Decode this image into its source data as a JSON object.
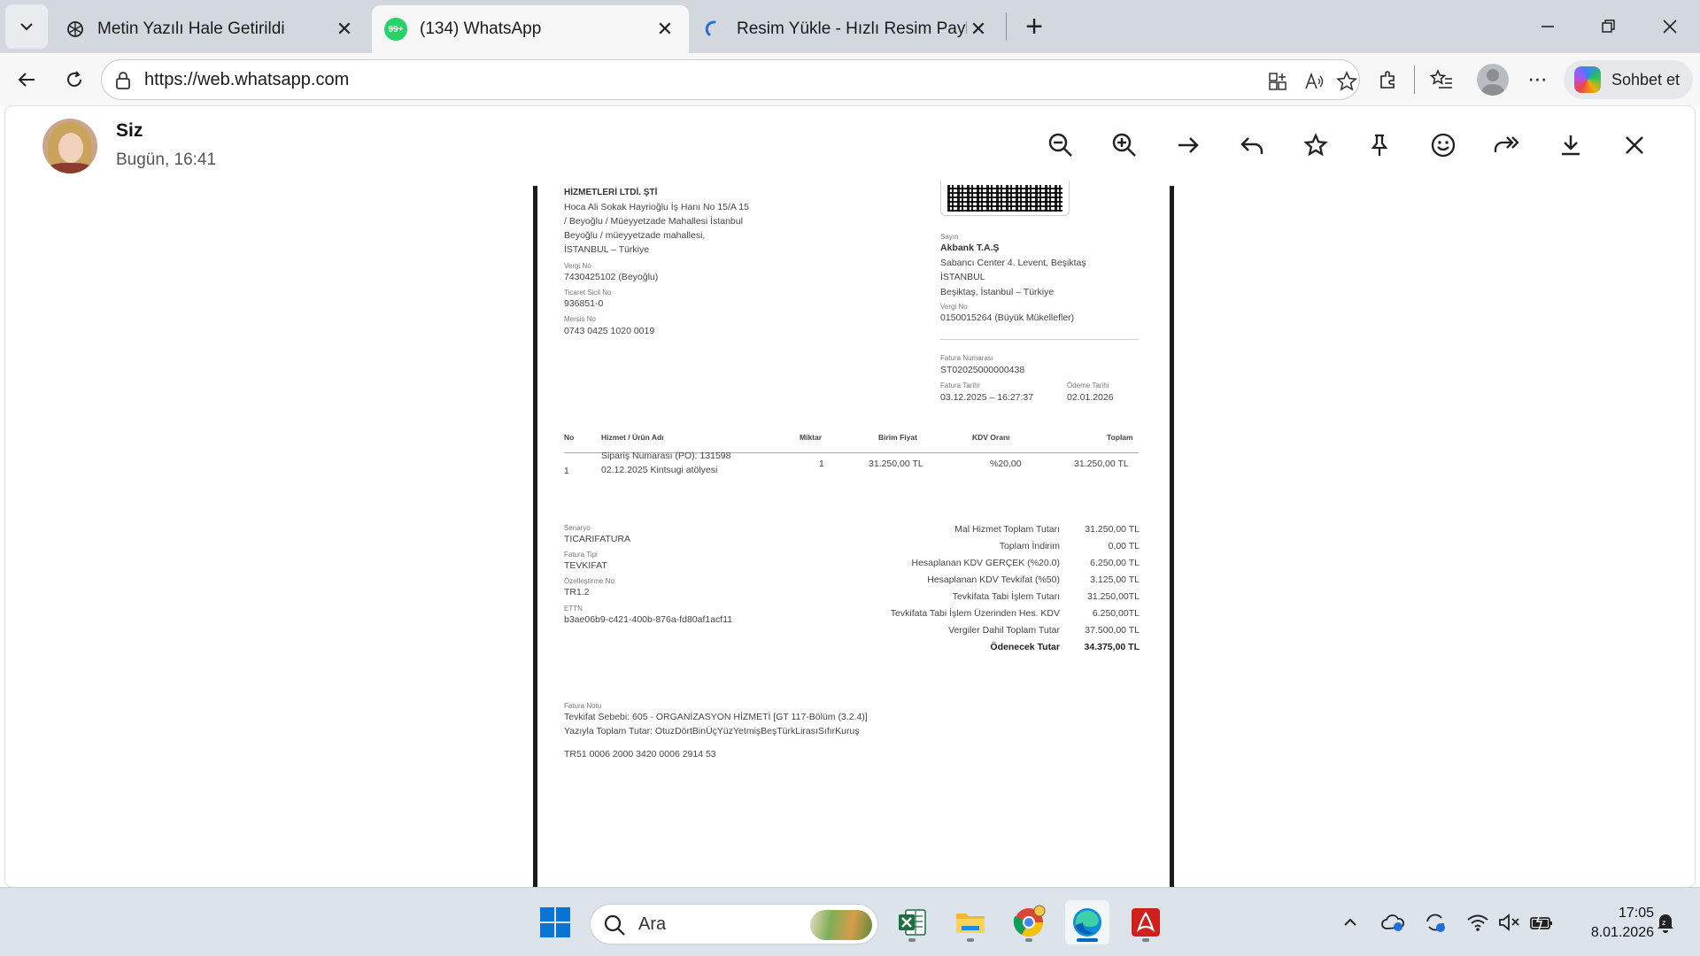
{
  "browser": {
    "tabs": [
      {
        "title": "Metin Yazılı Hale Getirildi",
        "icon": "chatgpt-icon"
      },
      {
        "title": "(134) WhatsApp",
        "icon": "whatsapp-icon",
        "badge": "99+",
        "active": true
      },
      {
        "title": "Resim Yükle - Hızlı Resim Paylaş - I",
        "icon": "loading-icon"
      }
    ],
    "url": "https://web.whatsapp.com",
    "copilot_label": "Sohbet et"
  },
  "viewer": {
    "sender": "Siz",
    "time": "Bugün, 16:41"
  },
  "invoice": {
    "seller": {
      "name_line": "HİZMETLERİ LTDİ. ŞTİ",
      "address": [
        "Hoca Ali Sokak Hayrioğlu İş Hanı No 15/A 15",
        "/ Beyoğlu / Müeyyetzade Mahallesi İstanbul",
        "Beyoğlu / müeyyetzade mahallesi,",
        "İSTANBUL – Türkiye"
      ],
      "tax_no_label": "Vergi No",
      "tax_no": "7430425102 (Beyoğlu)",
      "trade_reg_label": "Ticaret Sicil No",
      "trade_reg": "936851-0",
      "mersis_label": "Mersis No",
      "mersis": "0743 0425 1020 0019"
    },
    "buyer": {
      "label": "Sayın",
      "name": "Akbank T.A.Ş",
      "address": [
        "Sabancı Center 4. Levent, Beşiktaş",
        "İSTANBUL",
        "Beşiktaş, İstanbul – Türkiye"
      ],
      "tax_no_label": "Vergi No",
      "tax_no": "0150015264 (Büyük Mükellefler)"
    },
    "meta": {
      "invoice_no_label": "Fatura Numarası",
      "invoice_no": "ST02025000000438",
      "invoice_date_label": "Fatura Tarihi",
      "invoice_date": "03.12.2025 – 16:27:37",
      "due_date_label": "Ödeme Tarihi",
      "due_date": "02.01.2026"
    },
    "table": {
      "headers": [
        "No",
        "Hizmet / Ürün Adı",
        "Miktar",
        "Birim Fiyat",
        "KDV Oranı",
        "Toplam"
      ],
      "row": {
        "no": "1",
        "name_line1": "Sipariş Numarası (PO): 131598",
        "name_line2": "02.12.2025 Kintsugi atölyesi",
        "qty": "1",
        "unit_price": "31.250,00 TL",
        "vat": "%20,00",
        "total": "31.250,00 TL"
      }
    },
    "details": {
      "scenario_label": "Senaryo",
      "scenario": "TICARIFATURA",
      "type_label": "Fatura Tipi",
      "type": "TEVKIFAT",
      "custom_label": "Özelleştirme No",
      "custom": "TR1.2",
      "ettn_label": "ETTN",
      "ettn": "b3ae06b9-c421-400b-876a-fd80af1acf11"
    },
    "totals": [
      {
        "label": "Mal Hizmet Toplam Tutarı",
        "value": "31.250,00 TL"
      },
      {
        "label": "Toplam İndirim",
        "value": "0,00 TL"
      },
      {
        "label": "Hesaplanan KDV GERÇEK (%20.0)",
        "value": "6.250,00 TL"
      },
      {
        "label": "Hesaplanan KDV Tevkifat (%50)",
        "value": "3.125,00 TL"
      },
      {
        "label": "Tevkifata Tabi İşlem Tutarı",
        "value": "31.250,00TL"
      },
      {
        "label": "Tevkifata Tabi İşlem Üzerinden Hes. KDV",
        "value": "6.250,00TL"
      },
      {
        "label": "Vergiler Dahil Toplam Tutar",
        "value": "37.500,00 TL"
      },
      {
        "label": "Ödenecek Tutar",
        "value": "34.375,00 TL",
        "bold": true
      }
    ],
    "note": {
      "label": "Fatura Notu",
      "line1": "Tevkifat Sebebi: 605 - ORGANİZASYON HİZMETİ [GT 117-Bölüm (3.2.4)]",
      "line2": "Yazıyla Toplam Tutar: OtuzDörtBinÜçYüzYetmişBeşTürkLirasıSıfırKuruş",
      "iban": "TR51 0006 2000 3420 0006 2914 53"
    }
  },
  "taskbar": {
    "search_placeholder": "Ara",
    "time": "17:05",
    "date": "8.01.2026"
  },
  "colors": {
    "tabstrip": "#d3d8de",
    "whatsapp_green": "#25d366",
    "edge_blue": "#0067c0",
    "taskbar": "#dde3ea"
  }
}
